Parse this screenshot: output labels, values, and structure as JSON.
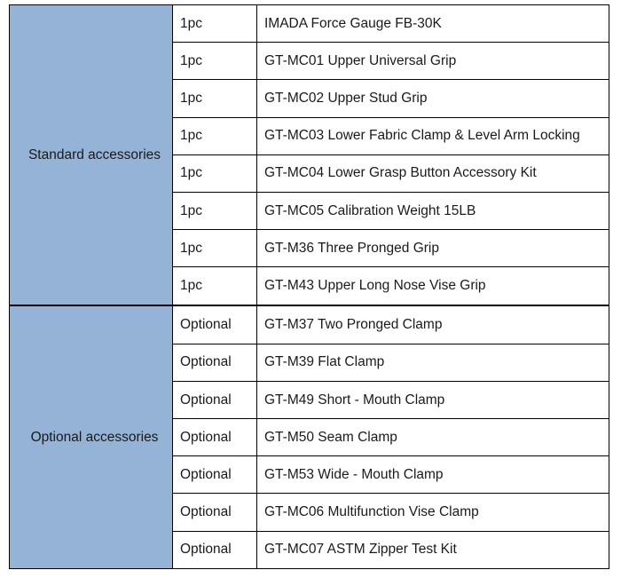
{
  "table": {
    "sections": [
      {
        "label": "Standard accessories",
        "rows": [
          {
            "qty": "1pc",
            "description": "IMADA Force Gauge FB-30K"
          },
          {
            "qty": "1pc",
            "description": "GT-MC01 Upper Universal Grip"
          },
          {
            "qty": "1pc",
            "description": "GT-MC02 Upper Stud Grip"
          },
          {
            "qty": "1pc",
            "description": "GT-MC03 Lower Fabric Clamp & Level Arm Locking"
          },
          {
            "qty": "1pc",
            "description": "GT-MC04 Lower Grasp Button Accessory Kit"
          },
          {
            "qty": "1pc",
            "description": "GT-MC05 Calibration Weight 15LB"
          },
          {
            "qty": "1pc",
            "description": "GT-M36 Three Pronged Grip"
          },
          {
            "qty": "1pc",
            "description": "GT-M43 Upper Long Nose Vise Grip"
          }
        ]
      },
      {
        "label": "Optional accessories",
        "rows": [
          {
            "qty": "Optional",
            "description": "GT-M37 Two Pronged Clamp"
          },
          {
            "qty": "Optional",
            "description": "GT-M39 Flat Clamp"
          },
          {
            "qty": "Optional",
            "description": "GT-M49 Short - Mouth Clamp"
          },
          {
            "qty": "Optional",
            "description": "GT-M50 Seam Clamp"
          },
          {
            "qty": "Optional",
            "description": "GT-M53 Wide - Mouth Clamp"
          },
          {
            "qty": "Optional",
            "description": "GT-MC06 Multifunction Vise Clamp"
          },
          {
            "qty": "Optional",
            "description": "GT-MC07 ASTM Zipper Test Kit"
          }
        ]
      }
    ]
  },
  "colors": {
    "group_background": "#95b3d7",
    "group_text": "#ffffff",
    "cell_text": "#1a1a1a",
    "border": "#000000",
    "cell_background": "#ffffff"
  }
}
